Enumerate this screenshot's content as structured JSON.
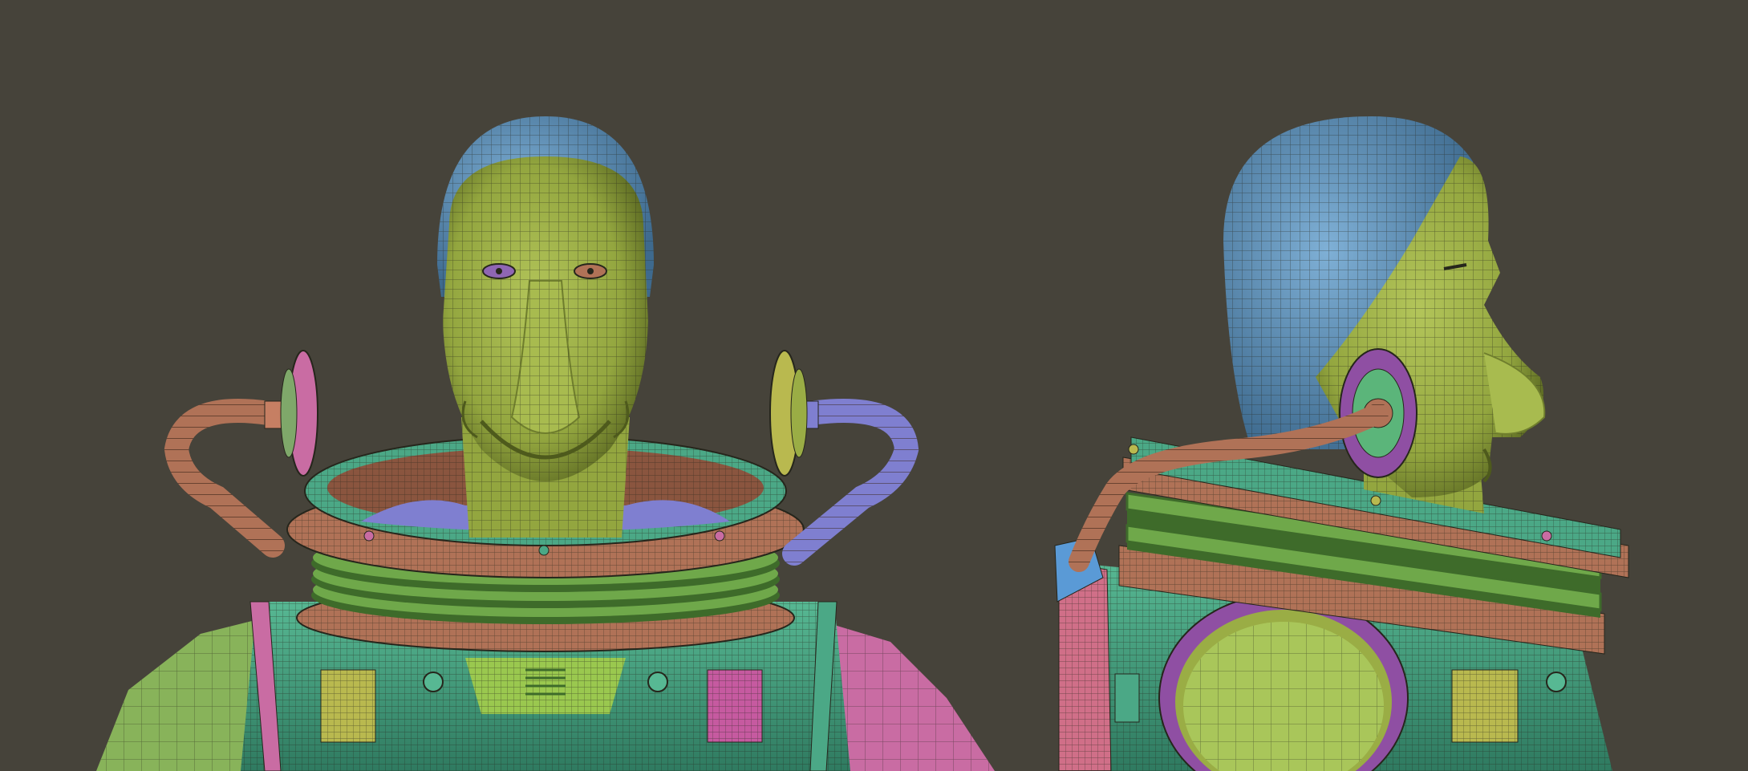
{
  "scene": {
    "background": "#46433a",
    "wire": "#26261c",
    "palette": {
      "skin_yellow_green": "#9aad45",
      "skin_shadow": "#6f7e2d",
      "cap_blue": "#5a88ad",
      "suit_teal": "#4ba886",
      "suit_teal_dark": "#2f7a60",
      "copper": "#b07257",
      "copper_dark": "#7a4a37",
      "bellows_green": "#6fa84a",
      "bellows_dark": "#3e6b2a",
      "magenta": "#c96ca3",
      "purple": "#8f66b3",
      "lavender": "#7f7fd0",
      "shoulder_green": "#88b35a"
    }
  }
}
